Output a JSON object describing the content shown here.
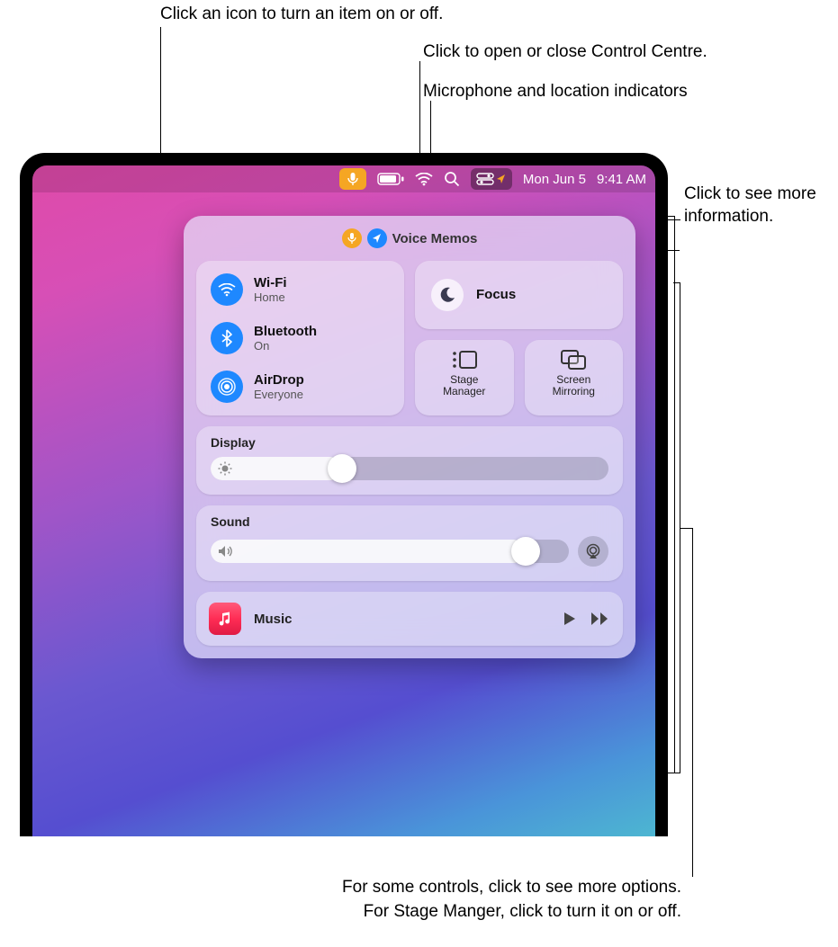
{
  "callouts": {
    "toggle_icon": "Click an icon to turn an item on or off.",
    "open_cc": "Click to open or close Control Centre.",
    "indicators": "Microphone and location indicators",
    "see_more": "Click to see more information.",
    "bottom1": "For some controls, click to see more options.",
    "bottom2": "For Stage Manger, click to turn it on or off."
  },
  "menubar": {
    "date": "Mon Jun 5",
    "time": "9:41 AM"
  },
  "control_centre": {
    "app_indicator": "Voice Memos",
    "network": {
      "wifi": {
        "title": "Wi-Fi",
        "sub": "Home"
      },
      "bluetooth": {
        "title": "Bluetooth",
        "sub": "On"
      },
      "airdrop": {
        "title": "AirDrop",
        "sub": "Everyone"
      }
    },
    "focus": {
      "title": "Focus"
    },
    "stage_manager": {
      "title": "Stage Manager"
    },
    "screen_mirroring": {
      "title": "Screen Mirroring"
    },
    "display": {
      "title": "Display",
      "value_pct": 33
    },
    "sound": {
      "title": "Sound",
      "value_pct": 88
    },
    "music": {
      "title": "Music"
    }
  }
}
